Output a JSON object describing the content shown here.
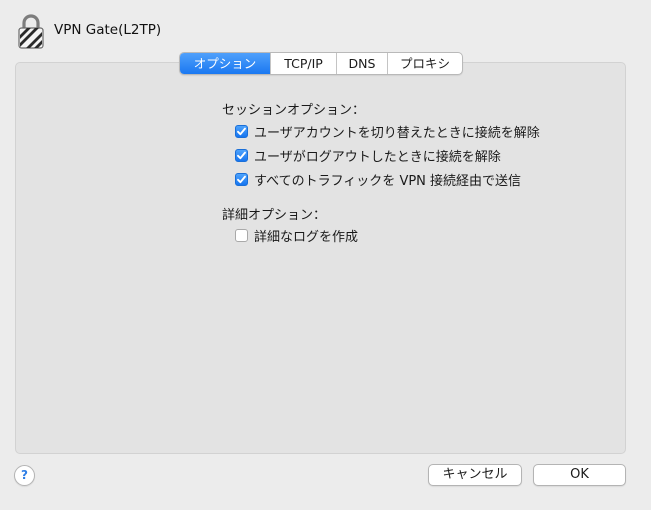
{
  "window": {
    "title": "VPN Gate(L2TP)"
  },
  "tabs": [
    {
      "label": "オプション",
      "active": true
    },
    {
      "label": "TCP/IP",
      "active": false
    },
    {
      "label": "DNS",
      "active": false
    },
    {
      "label": "プロキシ",
      "active": false
    }
  ],
  "session_options": {
    "heading": "セッションオプション：",
    "items": [
      {
        "label": "ユーザアカウントを切り替えたときに接続を解除",
        "checked": true
      },
      {
        "label": "ユーザがログアウトしたときに接続を解除",
        "checked": true
      },
      {
        "label": "すべてのトラフィックを VPN 接続経由で送信",
        "checked": true
      }
    ]
  },
  "advanced_options": {
    "heading": "詳細オプション：",
    "items": [
      {
        "label": "詳細なログを作成",
        "checked": false
      }
    ]
  },
  "footer": {
    "help_label": "?",
    "cancel_label": "キャンセル",
    "ok_label": "OK"
  },
  "colors": {
    "accent": "#1a78f1",
    "window_bg": "#ececec",
    "panel_bg": "#e3e3e3"
  },
  "icons": {
    "header": "vpn-lock-icon",
    "checkmark": "checkmark-icon"
  }
}
